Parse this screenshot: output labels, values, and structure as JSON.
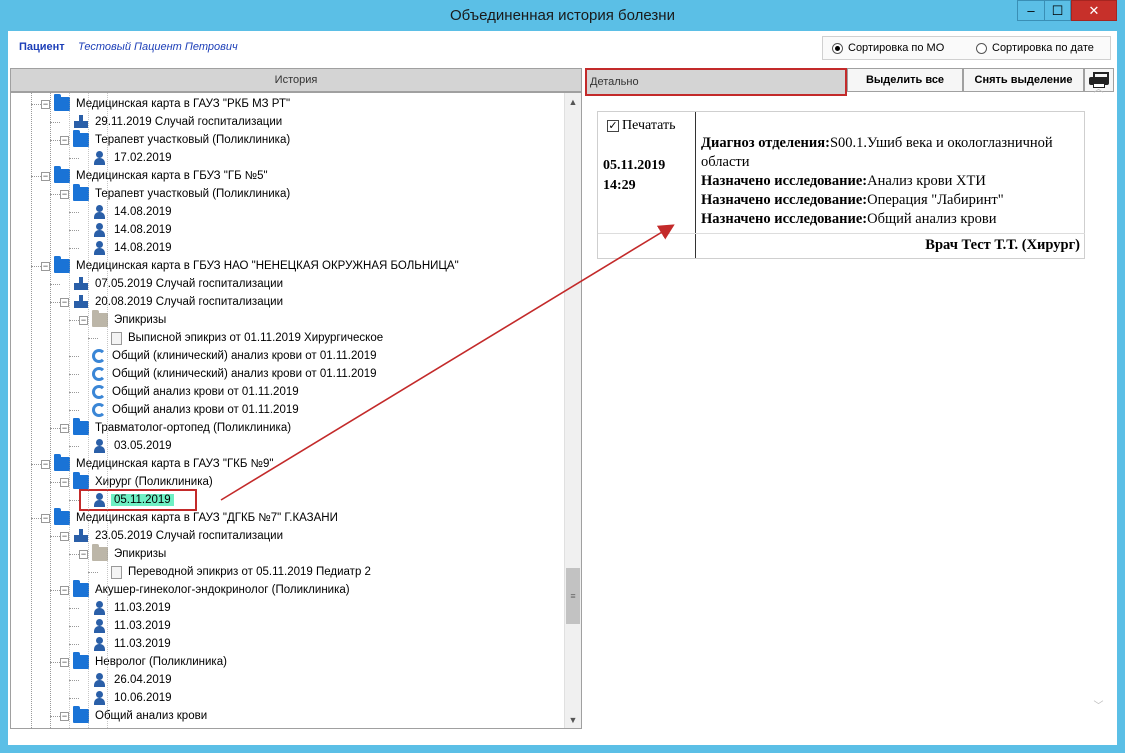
{
  "window": {
    "title": "Объединенная история болезни",
    "min_glyph": "‒",
    "max_glyph": "☐",
    "close_glyph": "✕"
  },
  "patient": {
    "label": "Пациент",
    "name": "Тестовый Пациент Петрович"
  },
  "sort": {
    "by_mo": "Сортировка по МО",
    "by_date": "Сортировка по дате",
    "selected": "by_mo"
  },
  "left_panel": {
    "header": "История"
  },
  "right_panel": {
    "header": "Детально",
    "select_all": "Выделить все",
    "clear_selection": "Снять выделение"
  },
  "tree": [
    {
      "level": 1,
      "icon": "folder-icon",
      "pm": "−",
      "label": "Медицинская карта в ГАУЗ \"РКБ МЗ РТ\""
    },
    {
      "level": 2,
      "icon": "hospital-icon",
      "pm": "",
      "label": "29.11.2019 Случай госпитализации"
    },
    {
      "level": 2,
      "icon": "folder-icon",
      "pm": "−",
      "label": "Терапевт участковый (Поликлиника)"
    },
    {
      "level": 3,
      "icon": "person-icon",
      "pm": "",
      "label": "17.02.2019"
    },
    {
      "level": 1,
      "icon": "folder-icon",
      "pm": "−",
      "label": "Медицинская карта в ГБУЗ \"ГБ №5\""
    },
    {
      "level": 2,
      "icon": "folder-icon",
      "pm": "−",
      "label": "Терапевт участковый (Поликлиника)"
    },
    {
      "level": 3,
      "icon": "person-icon",
      "pm": "",
      "label": "14.08.2019"
    },
    {
      "level": 3,
      "icon": "person-icon",
      "pm": "",
      "label": "14.08.2019"
    },
    {
      "level": 3,
      "icon": "person-icon",
      "pm": "",
      "label": "14.08.2019"
    },
    {
      "level": 1,
      "icon": "folder-icon",
      "pm": "−",
      "label": "Медицинская карта в ГБУЗ НАО \"НЕНЕЦКАЯ ОКРУЖНАЯ БОЛЬНИЦА\""
    },
    {
      "level": 2,
      "icon": "hospital-icon",
      "pm": "",
      "label": "07.05.2019 Случай госпитализации"
    },
    {
      "level": 2,
      "icon": "hospital-icon",
      "pm": "−",
      "label": "20.08.2019 Случай госпитализации"
    },
    {
      "level": 3,
      "icon": "epicrisis-folder-icon",
      "pm": "−",
      "label": "Эпикризы"
    },
    {
      "level": 4,
      "icon": "document-icon",
      "pm": "",
      "label": "Выписной эпикриз от 01.11.2019 Хирургическое"
    },
    {
      "level": 3,
      "icon": "lab-test-icon",
      "pm": "",
      "label": "Общий (клинический) анализ крови от 01.11.2019"
    },
    {
      "level": 3,
      "icon": "lab-test-icon",
      "pm": "",
      "label": "Общий (клинический) анализ крови от 01.11.2019"
    },
    {
      "level": 3,
      "icon": "lab-test-icon",
      "pm": "",
      "label": "Общий анализ крови от 01.11.2019"
    },
    {
      "level": 3,
      "icon": "lab-test-icon",
      "pm": "",
      "label": "Общий анализ крови от 01.11.2019"
    },
    {
      "level": 2,
      "icon": "folder-icon",
      "pm": "−",
      "label": "Травматолог-ортопед (Поликлиника)"
    },
    {
      "level": 3,
      "icon": "person-icon",
      "pm": "",
      "label": "03.05.2019"
    },
    {
      "level": 1,
      "icon": "folder-icon",
      "pm": "−",
      "label": "Медицинская карта в ГАУЗ \"ГКБ №9\""
    },
    {
      "level": 2,
      "icon": "folder-icon",
      "pm": "−",
      "label": "Хирург (Поликлиника)"
    },
    {
      "level": 3,
      "icon": "person-icon",
      "pm": "",
      "label": "05.11.2019",
      "selected": true
    },
    {
      "level": 1,
      "icon": "folder-icon",
      "pm": "−",
      "label": "Медицинская карта в ГАУЗ \"ДГКБ №7\" Г.КАЗАНИ"
    },
    {
      "level": 2,
      "icon": "hospital-icon",
      "pm": "−",
      "label": "23.05.2019 Случай госпитализации"
    },
    {
      "level": 3,
      "icon": "epicrisis-folder-icon",
      "pm": "−",
      "label": "Эпикризы"
    },
    {
      "level": 4,
      "icon": "document-icon",
      "pm": "",
      "label": "Переводной эпикриз от 05.11.2019 Педиатр 2"
    },
    {
      "level": 2,
      "icon": "folder-icon",
      "pm": "−",
      "label": "Акушер-гинеколог-эндокринолог (Поликлиника)"
    },
    {
      "level": 3,
      "icon": "person-icon",
      "pm": "",
      "label": "11.03.2019"
    },
    {
      "level": 3,
      "icon": "person-icon",
      "pm": "",
      "label": "11.03.2019"
    },
    {
      "level": 3,
      "icon": "person-icon",
      "pm": "",
      "label": "11.03.2019"
    },
    {
      "level": 2,
      "icon": "folder-icon",
      "pm": "−",
      "label": "Невролог (Поликлиника)"
    },
    {
      "level": 3,
      "icon": "person-icon",
      "pm": "",
      "label": "26.04.2019"
    },
    {
      "level": 3,
      "icon": "person-icon",
      "pm": "",
      "label": "10.06.2019"
    },
    {
      "level": 2,
      "icon": "folder-icon",
      "pm": "−",
      "label": "Общий анализ крови"
    }
  ],
  "detail": {
    "print_label": "Печатать",
    "print_checked": "✓",
    "date": "05.11.2019",
    "time": "14:29",
    "lines": [
      {
        "key": "Диагноз отделения:",
        "value": "S00.1.Ушиб века и окологлазничной области"
      },
      {
        "key": "Назначено исследование:",
        "value": "Анализ крови ХТИ"
      },
      {
        "key": "Назначено исследование:",
        "value": "Операция \"Лабиринт\""
      },
      {
        "key": "Назначено исследование:",
        "value": "Общий анализ крови"
      }
    ],
    "doctor": "Врач Тест Т.Т. (Хирург)"
  },
  "colors": {
    "titlebar": "#5bbfe6",
    "selection": "#6ef0c4",
    "annotation": "#c32a2a",
    "link_blue": "#1d3fb8"
  }
}
